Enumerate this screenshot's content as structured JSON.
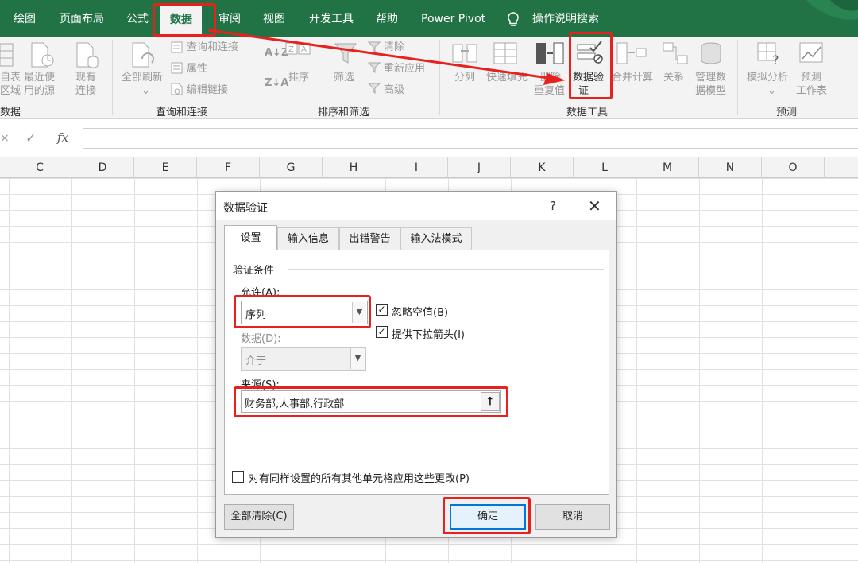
{
  "tabs": [
    "绘图",
    "页面布局",
    "公式",
    "数据",
    "审阅",
    "视图",
    "开发工具",
    "帮助",
    "Power Pivot"
  ],
  "active_tab": "数据",
  "tell_me": "操作说明搜索",
  "ribbon": {
    "get_data": {
      "item1": "自表",
      "item1b": "区域",
      "item2": "最近使",
      "item2b": "用的源",
      "item3": "现有",
      "item3b": "连接",
      "title": "数据"
    },
    "queries": {
      "refresh": "全部刷新",
      "queries_connections": "查询和连接",
      "properties": "属性",
      "edit_links": "编辑链接",
      "title": "查询和连接"
    },
    "sort_filter": {
      "sort": "排序",
      "filter": "筛选",
      "clear": "清除",
      "reapply": "重新应用",
      "advanced": "高级",
      "title": "排序和筛选"
    },
    "data_tools": {
      "split": "分列",
      "flash_fill": "快速填充",
      "remove_dup": "删除",
      "remove_dup2": "重复值",
      "validation": "数据验",
      "validation2": "证",
      "consolidate": "合并计算",
      "relations": "关系",
      "manage_model": "管理数",
      "manage_model2": "据模型",
      "title": "数据工具"
    },
    "forecast": {
      "what_if": "模拟分析",
      "forecast_sheet": "预测",
      "forecast_sheet2": "工作表",
      "title": "预测"
    }
  },
  "formula_bar": {
    "fx": "fx",
    "cancel": "×",
    "enter": "✓"
  },
  "columns": [
    "C",
    "D",
    "E",
    "F",
    "G",
    "H",
    "I",
    "J",
    "K",
    "L",
    "M",
    "N",
    "O"
  ],
  "dialog": {
    "title": "数据验证",
    "help": "?",
    "close": "✕",
    "tabs": [
      "设置",
      "输入信息",
      "出错警告",
      "输入法模式"
    ],
    "section_label": "验证条件",
    "allow_label": "允许(A):",
    "allow_value": "序列",
    "data_label": "数据(D):",
    "data_value": "介于",
    "ignore_blank": "忽略空值(B)",
    "ignore_blank_checked": true,
    "dropdown_arrow": "提供下拉箭头(I)",
    "dropdown_arrow_checked": true,
    "source_label": "来源(S):",
    "source_value": "财务部,人事部,行政部",
    "apply_all": "对有同样设置的所有其他单元格应用这些更改(P)",
    "apply_all_checked": false,
    "clear_all": "全部清除(C)",
    "ok": "确定",
    "cancel": "取消"
  },
  "colors": {
    "excel_green": "#217346",
    "annotation_red": "#e8211d",
    "ok_border": "#0078d7"
  }
}
